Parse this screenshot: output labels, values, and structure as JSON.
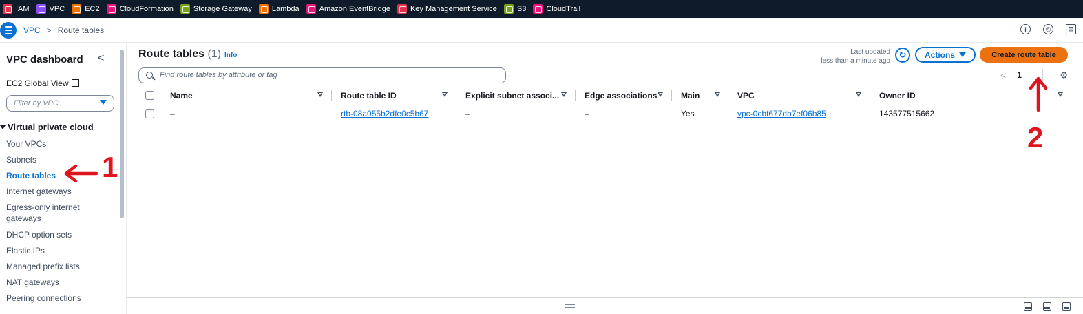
{
  "services": [
    {
      "label": "IAM",
      "color": "#dd344c"
    },
    {
      "label": "VPC",
      "color": "#8c4fff"
    },
    {
      "label": "EC2",
      "color": "#ed7100"
    },
    {
      "label": "CloudFormation",
      "color": "#e7157b"
    },
    {
      "label": "Storage Gateway",
      "color": "#7aa116"
    },
    {
      "label": "Lambda",
      "color": "#ed7100"
    },
    {
      "label": "Amazon EventBridge",
      "color": "#e7157b"
    },
    {
      "label": "Key Management Service",
      "color": "#dd344c"
    },
    {
      "label": "S3",
      "color": "#7aa116"
    },
    {
      "label": "CloudTrail",
      "color": "#e7157b"
    }
  ],
  "breadcrumb": {
    "root": "VPC",
    "separator": ">",
    "current": "Route tables"
  },
  "top_icons": {
    "info": "i",
    "notifications": "◎",
    "feedback": "⊡"
  },
  "sidebar": {
    "title": "VPC dashboard",
    "collapse": "<",
    "global_view": "EC2 Global View",
    "filter_placeholder": "Filter by VPC",
    "section": "Virtual private cloud",
    "items": [
      "Your VPCs",
      "Subnets",
      "Route tables",
      "Internet gateways",
      "Egress-only internet gateways",
      "DHCP option sets",
      "Elastic IPs",
      "Managed prefix lists",
      "NAT gateways",
      "Peering connections"
    ],
    "active_index": 2
  },
  "annotations": {
    "left_number": "1",
    "right_number": "2",
    "color": "#e0141e"
  },
  "main": {
    "title": "Route tables",
    "count": "(1)",
    "info": "Info",
    "last_updated_label": "Last updated",
    "last_updated_value": "less than a minute ago",
    "actions_label": "Actions",
    "create_label": "Create route table",
    "search_placeholder": "Find route tables by attribute or tag",
    "page_prev": "<",
    "page_number": "1",
    "settings_icon": "gear-icon"
  },
  "table": {
    "columns": [
      "Name",
      "Route table ID",
      "Explicit subnet associ...",
      "Edge associations",
      "Main",
      "VPC",
      "Owner ID"
    ],
    "rows": [
      {
        "name": "–",
        "route_table_id": "rtb-08a055b2dfe0c5b67",
        "explicit_subnet": "–",
        "edge": "–",
        "main": "Yes",
        "vpc": "vpc-0cbf677db7ef06b85",
        "owner_id": "143577515662"
      }
    ]
  },
  "colors": {
    "accent": "#0972d3",
    "primary_button": "#ec7211",
    "topbar": "#0f1b2a"
  }
}
